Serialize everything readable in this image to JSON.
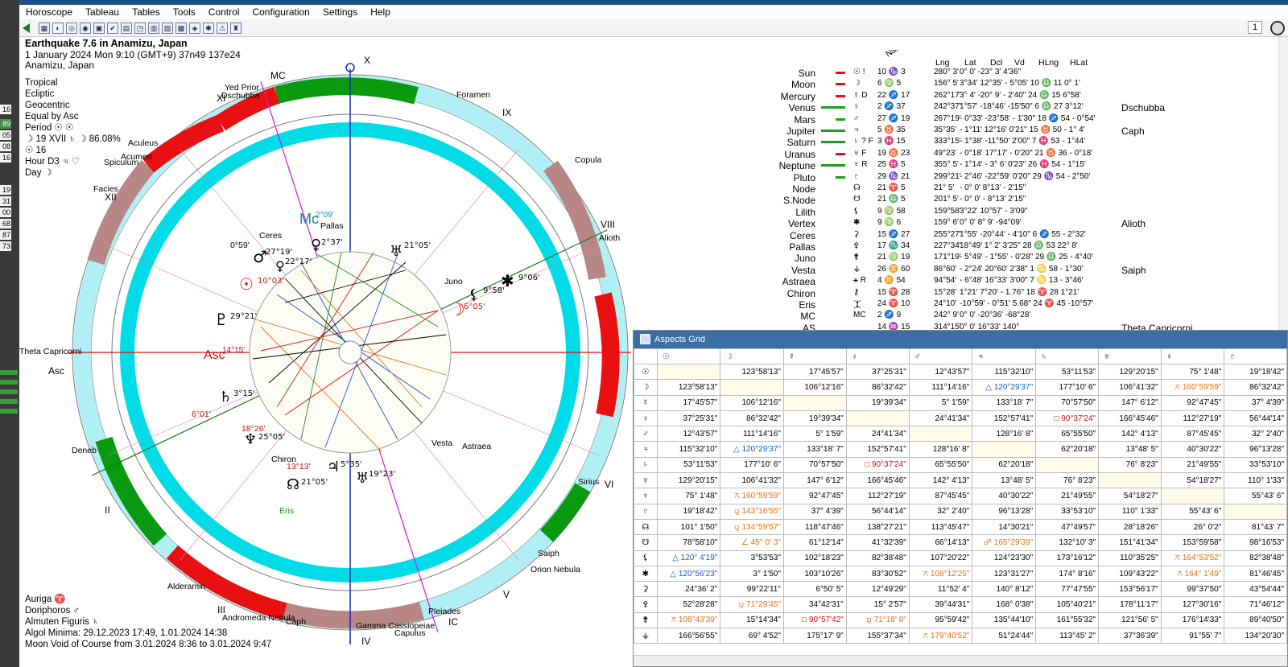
{
  "menu": [
    "Horoscope",
    "Tableau",
    "Tables",
    "Tools",
    "Control",
    "Configuration",
    "Settings",
    "Help"
  ],
  "toolbar": {
    "page_number": "1"
  },
  "leftstrip": [
    "16",
    "89",
    "05",
    "08",
    "16",
    "19",
    "31",
    "00",
    "68",
    "87",
    "73"
  ],
  "chart": {
    "title": "Earthquake 7.6 in Anamizu, Japan",
    "line2": "1 January 2024  Mon   9:10 (GMT+9) 37n49  137e24",
    "line3": "Anamizu, Japan",
    "settings": [
      "Tropical",
      "Ecliptic",
      "Geocentric",
      "Equal by Asc"
    ],
    "period": "Period ☉ ☉",
    "moonline": "☽ 19 XVII ♄ ☽ 86.08%",
    "sunline": "☉ 16",
    "hour": "Hour D3 ♃ ♡",
    "day": "Day ☽",
    "auriga": "Auriga ♈",
    "doriphoros": "Doriphoros ♂",
    "almuten": "Almuten Figuris ♄",
    "algol": "Algol Minima: 29.12.2023 17:49,  1.01.2024 14:38",
    "void": "Moon Void of Course from 3.01.2024  8:36 to 3.01.2024  9:47"
  },
  "wheel": {
    "labels": {
      "x": "X",
      "mc": "MC",
      "asc": "Asc",
      "ic": "IC",
      "iv": "IV",
      "v": "V",
      "vi": "VI",
      "vii": "VII",
      "viii": "VIII",
      "ix": "IX",
      "xi": "XI",
      "xii": "XII",
      "ii": "II",
      "iii": "III",
      "mc_text": "Mc",
      "mc_deg": "2°09'",
      "asc_text": "Asc",
      "asc_deg": "14°15'"
    },
    "stars": [
      "Yed Prior",
      "Dschubba",
      "Foramen",
      "Copula",
      "Alioth",
      "Acumen",
      "Aculeus",
      "Spiculum",
      "Facies",
      "Deneb",
      "Alderamin",
      "Andromeda Nebula",
      "Caph",
      "Gamma Cassiopeiae",
      "Capulus",
      "Pleiades",
      "Orion Nebula",
      "Saiph",
      "Sirius",
      "Theta Capricorni"
    ],
    "planets": [
      {
        "glyph": "♂",
        "deg": "27°19'"
      },
      {
        "glyph": "♀",
        "deg": "22°17'"
      },
      {
        "glyph": "♀",
        "deg": "2°37'"
      },
      {
        "glyph": "♅",
        "deg": "21°05'"
      },
      {
        "glyph": "☉",
        "deg": "10°03'"
      },
      {
        "glyph": "♇",
        "deg": "29°21'"
      },
      {
        "glyph": "♄",
        "deg": "3°15'"
      },
      {
        "glyph": "♆",
        "deg": "25°05'"
      },
      {
        "glyph": "♃",
        "deg": "5°35'"
      },
      {
        "glyph": "♅",
        "deg": "19°23'"
      },
      {
        "glyph": "☊",
        "deg": "21°05'"
      },
      {
        "glyph": "☽",
        "deg": "6°05'"
      },
      {
        "glyph": "⚸",
        "deg": "9°58'"
      },
      {
        "glyph": "✱",
        "deg": "9°06'"
      }
    ],
    "minor": [
      "Ceres",
      "Pallas",
      "Juno",
      "Vesta",
      "Astraea",
      "Chiron",
      "Eris"
    ],
    "minor_deg": {
      "chiron": "13°13'",
      "ceres_small": "0°59'",
      "neptune_small": "18°26'",
      "uranus_small": "6°01'"
    }
  },
  "planet_table": {
    "headers": [
      "Nat",
      "Lng",
      "Lat",
      "Dcl",
      "Vd",
      "HLng",
      "HLat"
    ],
    "rows": [
      {
        "name": "Sun",
        "sym": "☉ !",
        "pos": "10 ♑ 3",
        "lng": "280° 3'",
        "rest": "0° 0'  -23° 3'  4'36\"",
        "star": ""
      },
      {
        "name": "Moon",
        "sym": "☽",
        "pos": "6 ♍ 5",
        "lng": "156° 5'",
        "rest": "3°34'  12°35'  - 5°05'  10 ♎ 11  0° 1'",
        "star": ""
      },
      {
        "name": "Mercury",
        "sym": "☿ D",
        "pos": "22 ♐ 17",
        "lng": "262°17'",
        "rest": "3° 4'  -20° 9'  - 2'40\"  24 ♎ 15  6°58'",
        "star": ""
      },
      {
        "name": "Venus",
        "sym": "♀",
        "pos": "2 ♐ 37",
        "lng": "242°37'",
        "rest": "1°57'  -18°46'  -15'50\"  6 ♎ 27  3°12'",
        "star": "Dschubba"
      },
      {
        "name": "Mars",
        "sym": "♂",
        "pos": "27 ♐ 19",
        "lng": "267°19'",
        "rest": "- 0°33'  -23°58'  - 1'30\"  18 ♐ 54  - 0°54'",
        "star": ""
      },
      {
        "name": "Jupiter",
        "sym": "♃",
        "pos": "5 ♉ 35",
        "lng": "35°35'",
        "rest": "- 1°11'  12°16'  0'21\"  15 ♉ 50  - 1° 4'",
        "star": "Caph"
      },
      {
        "name": "Saturn",
        "sym": "♄ ? F",
        "pos": "3 ♓ 15",
        "lng": "333°15'",
        "rest": "- 1°38'  -11°50'  2'00\"  7 ♓ 53  - 1°44'",
        "star": ""
      },
      {
        "name": "Uranus",
        "sym": "♅ F",
        "pos": "19 ♉ 23",
        "lng": "49°23'",
        "rest": "- 0°18'  17°17'  - 0'20\"  21 ♉ 36  - 0°18'",
        "star": ""
      },
      {
        "name": "Neptune",
        "sym": "♆ R",
        "pos": "25 ♓ 5",
        "lng": "355° 5'",
        "rest": "- 1°14'  - 3° 6'  0'23\"  26 ♓ 54  - 1°15'",
        "star": ""
      },
      {
        "name": "Pluto",
        "sym": "♇",
        "pos": "29 ♑ 21",
        "lng": "299°21'",
        "rest": "- 2°46'  -22°59'  0'20\"  29 ♑ 54  - 2°50'",
        "star": ""
      },
      {
        "name": "Node",
        "sym": "☊",
        "pos": "21 ♈ 5",
        "lng": "21° 5'",
        "rest": "- 0° 0'  8°13'  - 2'15\"",
        "star": ""
      },
      {
        "name": "S.Node",
        "sym": "☋",
        "pos": "21 ♎ 5",
        "lng": "201° 5'",
        "rest": "- 0° 0'  - 8°13'  2'15\"",
        "star": ""
      },
      {
        "name": "Lilith",
        "sym": "⚸",
        "pos": "9 ♍ 58",
        "lng": "159°58'",
        "rest": "3°22'  10°57'  - 3'09\"",
        "star": ""
      },
      {
        "name": "Vertex",
        "sym": "✱",
        "pos": "9 ♍ 6",
        "lng": "159° 6'",
        "rest": "0° 0'  8° 9'  -94°09'",
        "star": "Alioth"
      },
      {
        "name": "Ceres",
        "sym": "⚳",
        "pos": "15 ♐ 27",
        "lng": "255°27'",
        "rest": "1°55'  -20°44'  - 4'10\"  6 ♐ 55  - 2°32'",
        "star": ""
      },
      {
        "name": "Pallas",
        "sym": "⚴",
        "pos": "17 ♏ 34",
        "lng": "227°34'",
        "rest": "18°49'  1° 2'  3'25\"  28 ♎ 53  22° 8'",
        "star": ""
      },
      {
        "name": "Juno",
        "sym": "⚵",
        "pos": "21 ♍ 19",
        "lng": "171°19'",
        "rest": "- 5°49'  - 1°55'  - 0'28\"  29 ♎ 25  - 4°40'",
        "star": ""
      },
      {
        "name": "Vesta",
        "sym": "⚶",
        "pos": "26 ♊ 60",
        "lng": "86°60'",
        "rest": "- 2°24'  20°60'  2'38\"  1 ♋ 58  - 1°30'",
        "star": "Saiph"
      },
      {
        "name": "Astraea",
        "sym": "⚹ R",
        "pos": "4 ♊ 54",
        "lng": "94°54'",
        "rest": "- 6°48'  16°33'  3'00\"  7 ♋ 13  - 3°46'",
        "star": ""
      },
      {
        "name": "Chiron",
        "sym": "⚷",
        "pos": "15 ♈ 28",
        "lng": "15°28'",
        "rest": "1°21'  7°20'  - 1.76\"  18 ♈ 28  1°21'",
        "star": ""
      },
      {
        "name": "Eris",
        "sym": "⯰",
        "pos": "24 ♈ 10",
        "lng": "24°10'",
        "rest": "-10°59'  - 0°51'  5.68\"  24 ♈ 45  -10°57'",
        "star": ""
      },
      {
        "name": "MC",
        "sym": "MC",
        "pos": "2 ♐ 9",
        "lng": "242° 9'",
        "rest": "0° 0'  -20°36'  -68°28'",
        "star": ""
      },
      {
        "name": "AS",
        "sym": "",
        "pos": "14 ♒ 15",
        "lng": "314°15'",
        "rest": "0° 0'  16°33'  140°",
        "star": "Theta Capricorni"
      }
    ]
  },
  "aspects": {
    "title": "Aspects Grid",
    "cols": [
      "☉",
      "☽",
      "☿",
      "♀",
      "♂",
      "♃",
      "♄",
      "♅",
      "♆",
      "♇"
    ],
    "rows": [
      {
        "h": "☉",
        "c": [
          "",
          "123°58'13\"",
          "17°45'57\"",
          "37°25'31\"",
          "12°43'57\"",
          "115°32'10\"",
          "53°11'53\"",
          "129°20'15\"",
          "75° 1'48\"",
          "19°18'42\""
        ]
      },
      {
        "h": "☽",
        "c": [
          "123°58'13\"",
          "",
          "106°12'16\"",
          "86°32'42\"",
          "111°14'16\"",
          "△ 120°29'37\"",
          "177°10' 6\"",
          "106°41'32\"",
          "⚻ 160°59'59\"",
          "86°32'42\""
        ]
      },
      {
        "h": "☿",
        "c": [
          "17°45'57\"",
          "106°12'16\"",
          "",
          "19°39'34\"",
          "5° 1'59\"",
          "133°18' 7\"",
          "70°57'50\"",
          "147° 6'12\"",
          "92°47'45\"",
          "37° 4'39\""
        ]
      },
      {
        "h": "♀",
        "c": [
          "37°25'31\"",
          "86°32'42\"",
          "19°39'34\"",
          "",
          "24°41'34\"",
          "152°57'41\"",
          "□ 90°37'24\"",
          "166°45'46\"",
          "112°27'19\"",
          "56°44'14\""
        ]
      },
      {
        "h": "♂",
        "c": [
          "12°43'57\"",
          "111°14'16\"",
          "5° 1'59\"",
          "24°41'34\"",
          "",
          "128°16' 8\"",
          "65°55'50\"",
          "142° 4'13\"",
          "87°45'45\"",
          "32° 2'40\""
        ]
      },
      {
        "h": "♃",
        "c": [
          "115°32'10\"",
          "△ 120°29'37\"",
          "133°18' 7\"",
          "152°57'41\"",
          "128°16' 8\"",
          "",
          "62°20'18\"",
          "13°48' 5\"",
          "40°30'22\"",
          "96°13'28\""
        ]
      },
      {
        "h": "♄",
        "c": [
          "53°11'53\"",
          "177°10' 6\"",
          "70°57'50\"",
          "□ 90°37'24\"",
          "65°55'50\"",
          "62°20'18\"",
          "",
          "76° 8'23\"",
          "21°49'55\"",
          "33°53'10\""
        ]
      },
      {
        "h": "♅",
        "c": [
          "129°20'15\"",
          "106°41'32\"",
          "147° 6'12\"",
          "166°45'46\"",
          "142° 4'13\"",
          "13°48' 5\"",
          "76° 8'23\"",
          "",
          "54°18'27\"",
          "110° 1'33\""
        ]
      },
      {
        "h": "♆",
        "c": [
          "75° 1'48\"",
          "⚻ 160°59'59\"",
          "92°47'45\"",
          "112°27'19\"",
          "87°45'45\"",
          "40°30'22\"",
          "21°49'55\"",
          "54°18'27\"",
          "",
          "55°43' 6\""
        ]
      },
      {
        "h": "♇",
        "c": [
          "19°18'42\"",
          "⚼ 143°16'55\"",
          "37° 4'39\"",
          "56°44'14\"",
          "32° 2'40\"",
          "96°13'28\"",
          "33°53'10\"",
          "110° 1'33\"",
          "55°43' 6\"",
          ""
        ]
      },
      {
        "h": "☊",
        "c": [
          "101° 1'50\"",
          "⚼ 134°59'57\"",
          "118°47'46\"",
          "138°27'21\"",
          "113°45'47\"",
          "14°30'21\"",
          "47°49'57\"",
          "28°18'26\"",
          "26° 0'2\"",
          "81°43' 7\""
        ]
      },
      {
        "h": "☋",
        "c": [
          "78°58'10\"",
          "∠ 45° 0' 3\"",
          "61°12'14\"",
          "41°32'39\"",
          "66°14'13\"",
          "☍ 165°29'39\"",
          "132°10' 3\"",
          "151°41'34\"",
          "153°59'58\"",
          "98°16'53\""
        ]
      },
      {
        "h": "⚸",
        "c": [
          "△ 120° 4'19\"",
          "3°53'53\"",
          "102°18'23\"",
          "82°38'48\"",
          "107°20'22\"",
          "124°23'30\"",
          "173°16'12\"",
          "110°35'25\"",
          "⚻ 164°53'52\"",
          "82°38'48\""
        ]
      },
      {
        "h": "✱",
        "c": [
          "△ 120°56'23\"",
          "3° 1'50\"",
          "103°10'26\"",
          "83°30'52\"",
          "⚻ 108°12'25\"",
          "123°31'27\"",
          "174° 8'16\"",
          "109°43'22\"",
          "⚻ 164° 1'49\"",
          "81°46'45\""
        ]
      },
      {
        "h": "⚳",
        "c": [
          "24°36' 2\"",
          "99°22'11\"",
          "6°50' 5\"",
          "12°49'29\"",
          "11°52' 4\"",
          "140° 8'12\"",
          "77°47'55\"",
          "153°56'17\"",
          "99°37'50\"",
          "43°54'44\""
        ]
      },
      {
        "h": "⚴",
        "c": [
          "52°28'28\"",
          "⚼ 71°29'45\"",
          "34°42'31\"",
          "15° 2'57\"",
          "39°44'31\"",
          "168° 0'38\"",
          "105°40'21\"",
          "178°11'17\"",
          "127°30'16\"",
          "71°46'12\""
        ]
      },
      {
        "h": "⚵",
        "c": [
          "⚻ 108°43'39\"",
          "15°14'34\"",
          "□ 90°57'42\"",
          "⚼ 71°18' 8\"",
          "95°59'42\"",
          "135°44'10\"",
          "161°55'32\"",
          "121°56' 5\"",
          "176°14'33\"",
          "89°40'50\""
        ]
      },
      {
        "h": "⚶",
        "c": [
          "166°56'55\"",
          "69° 4'52\"",
          "175°17' 9\"",
          "155°37'34\"",
          "⚻ 179°40'52\"",
          "51°24'44\"",
          "113°45' 2\"",
          "37°36'39\"",
          "91°55' 7\"",
          "134°20'30\""
        ]
      }
    ]
  }
}
